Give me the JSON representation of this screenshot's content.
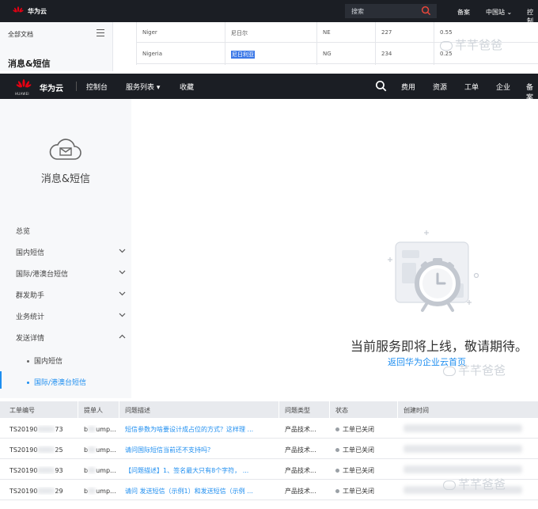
{
  "top": {
    "brand": "华为云",
    "search_placeholder": "搜索",
    "nav": [
      "备案",
      "中国站",
      "控制"
    ],
    "sidebar_all_docs": "全部文档",
    "sidebar_section": "消息&短信",
    "rows": [
      {
        "en": "Niger",
        "cn": "尼日尔",
        "code": "NE",
        "num": "227",
        "price": "0.55"
      },
      {
        "en": "Nigeria",
        "cn": "尼日利亚",
        "code": "NG",
        "num": "234",
        "price": "0.25"
      }
    ]
  },
  "header": {
    "logo_text": "HUAWEI",
    "brand": "华为云",
    "nav_left": [
      "控制台",
      "服务列表 ▾",
      "收藏"
    ],
    "nav_right": [
      "费用",
      "资源",
      "工单",
      "企业",
      "备案"
    ]
  },
  "sidebar": {
    "service_title": "消息&短信",
    "items": [
      {
        "label": "总览",
        "chevron": ""
      },
      {
        "label": "国内短信",
        "chevron": "down"
      },
      {
        "label": "国际/港澳台短信",
        "chevron": "down"
      },
      {
        "label": "群发助手",
        "chevron": "down"
      },
      {
        "label": "业务统计",
        "chevron": "down"
      },
      {
        "label": "发送详情",
        "chevron": "up"
      }
    ],
    "sub_items": [
      {
        "label": "国内短信",
        "active": false
      },
      {
        "label": "国际/港澳台短信",
        "active": true
      }
    ]
  },
  "main": {
    "coming_soon": "当前服务即将上线，敬请期待。",
    "back_link": "返回华为企业云首页"
  },
  "watermark": "芊芊爸爸",
  "tickets": {
    "columns": [
      "工单编号",
      "提单人",
      "问题描述",
      "问题类型",
      "状态",
      "创建时间"
    ],
    "rows": [
      {
        "id": "TS20190",
        "id_tail": "73",
        "user": "b",
        "user_tail": "ump...",
        "desc": "短信参数为啥要设计成占位的方式？这样理 ...",
        "type": "产品技术...",
        "status": "工单已关闭"
      },
      {
        "id": "TS20190",
        "id_tail": "25",
        "user": "b",
        "user_tail": "ump...",
        "desc": "请问国际短信当前还不支持吗？",
        "type": "产品技术...",
        "status": "工单已关闭"
      },
      {
        "id": "TS20190",
        "id_tail": "93",
        "user": "b",
        "user_tail": "ump...",
        "desc": "【问题描述】1、签名最大只有8个字符， ...",
        "type": "产品技术...",
        "status": "工单已关闭"
      },
      {
        "id": "TS20190",
        "id_tail": "29",
        "user": "b",
        "user_tail": "ump...",
        "desc": "请问 发送短信（示例1）和发送短信（示例 ...",
        "type": "产品技术...",
        "status": "工单已关闭"
      }
    ]
  },
  "colors": {
    "header_bg": "#1b1e24",
    "accent": "#1e8ef0",
    "sidebar_bg": "#f7f8fa",
    "brand_red": "#e60012"
  }
}
